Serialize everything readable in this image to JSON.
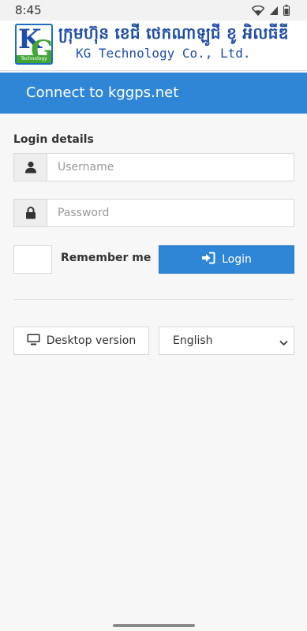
{
  "status_bar": {
    "time": "8:45"
  },
  "header": {
    "logo_letters": "KG",
    "logo_subtext": "Technology",
    "company_khmer": "ក្រុមហ៊ុន ខេជី ថេកណាឡូជី ខូ អិលធីឌី",
    "company_english": "KG Technology Co., Ltd."
  },
  "banner": {
    "title": "Connect to kggps.net"
  },
  "login": {
    "section_label": "Login details",
    "username_placeholder": "Username",
    "password_placeholder": "Password",
    "remember_label": "Remember me",
    "login_label": "Login"
  },
  "footer": {
    "desktop_label": "Desktop version",
    "language_value": "English"
  },
  "colors": {
    "brand_blue": "#2f86d6",
    "logo_blue": "#1f4ea8",
    "logo_green": "#3fa535"
  },
  "icons": [
    "wifi-icon",
    "signal-icon",
    "battery-icon",
    "user-icon",
    "lock-icon",
    "sign-in-icon",
    "desktop-icon",
    "chevron-down-icon"
  ]
}
